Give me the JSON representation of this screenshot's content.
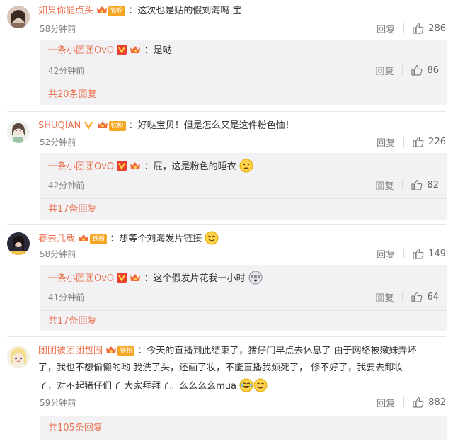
{
  "labels": {
    "reply": "回复"
  },
  "badges": {
    "fan": "铁粉"
  },
  "colors": {
    "accent": "#eb7350",
    "time": "#808080",
    "reply_bg": "#f2f2f5"
  },
  "comments": [
    {
      "user": "如果你能点头",
      "text": "这次也是贴的假刘海吗 宝",
      "time": "58分钟前",
      "likes": "286",
      "reply": {
        "user": "一条小团团OvO",
        "text": "是哒",
        "time": "42分钟前",
        "likes": "86"
      },
      "more": "共20条回复"
    },
    {
      "user": "SHUQIAN",
      "text": "好哒宝贝！但是怎么又是这件粉色恤！",
      "time": "52分钟前",
      "likes": "226",
      "reply": {
        "user": "一条小团团OvO",
        "text": "屁，这是粉色的睡衣",
        "time": "42分钟前",
        "likes": "82"
      },
      "more": "共17条回复"
    },
    {
      "user": "春去几载",
      "text": "想等个刘海发片链接",
      "time": "58分钟前",
      "likes": "149",
      "reply": {
        "user": "一条小团团OvO",
        "text": "这个假发片花我一小时",
        "time": "41分钟前",
        "likes": "64"
      },
      "more": "共17条回复"
    },
    {
      "user": "团团被团团包围",
      "text1": "今天的直播到此结束了，猪仔门早点去休息了 由于网络被嫩妹弄坏",
      "text2": "了，我也不想偷懒的哟 我洗了头，还画了妆，不能直播我烦死了， 修不好了，我要去卸妆",
      "text3": "了，对不起猪仔们了 大家拜拜了。么么么么mua",
      "time": "59分钟前",
      "likes": "882",
      "more": "共105条回复"
    }
  ]
}
